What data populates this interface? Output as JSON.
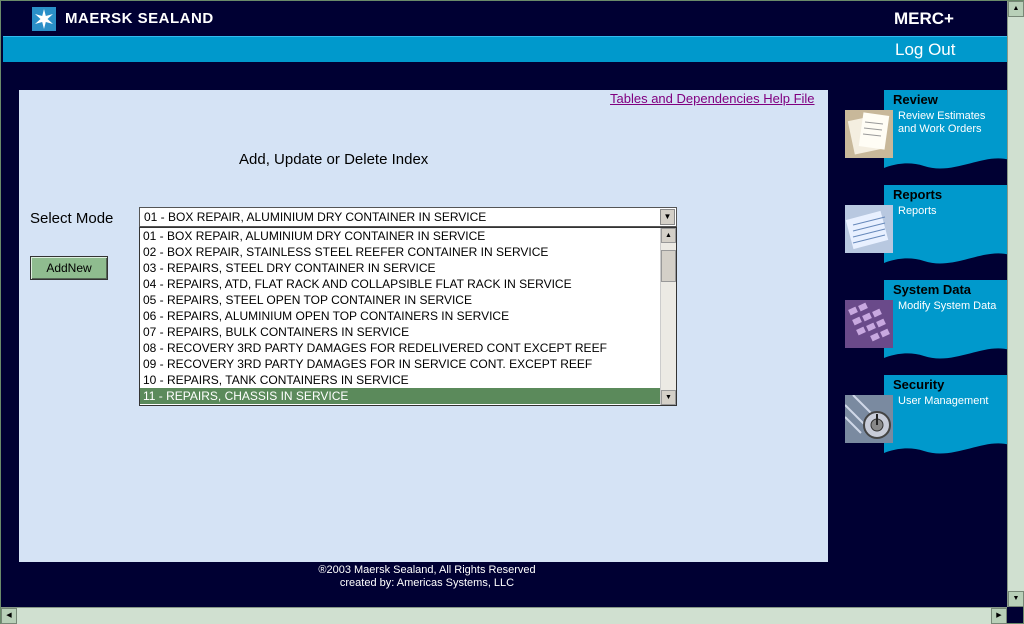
{
  "header": {
    "brand": "MAERSK SEALAND",
    "app_title": "MERC+",
    "logout": "Log Out"
  },
  "main": {
    "help_link": "Tables and Dependencies Help File",
    "title": "Add, Update or Delete Index",
    "select_mode_label": "Select Mode",
    "select_value": "01 - BOX REPAIR, ALUMINIUM DRY CONTAINER IN SERVICE",
    "add_new": "AddNew",
    "options": [
      "01 - BOX REPAIR, ALUMINIUM DRY CONTAINER IN SERVICE",
      "02 - BOX REPAIR, STAINLESS STEEL REEFER CONTAINER IN SERVICE",
      "03 - REPAIRS, STEEL DRY CONTAINER IN SERVICE",
      "04 - REPAIRS, ATD, FLAT RACK AND COLLAPSIBLE FLAT RACK IN SERVICE",
      "05 - REPAIRS, STEEL OPEN TOP CONTAINER IN SERVICE",
      "06 - REPAIRS, ALUMINIUM OPEN TOP CONTAINERS IN SERVICE",
      "07 - REPAIRS, BULK CONTAINERS IN SERVICE",
      "08 - RECOVERY 3RD PARTY DAMAGES FOR REDELIVERED CONT EXCEPT REEF",
      "09 - RECOVERY 3RD PARTY DAMAGES FOR IN SERVICE CONT. EXCEPT REEF",
      "10 - REPAIRS, TANK CONTAINERS IN SERVICE",
      "11 - REPAIRS, CHASSIS IN SERVICE"
    ],
    "selected_index": 10
  },
  "sidebar": [
    {
      "title": "Review",
      "links": [
        "Review Estimates",
        "and Work Orders"
      ],
      "icon": "documents-icon"
    },
    {
      "title": "Reports",
      "links": [
        "Reports"
      ],
      "icon": "reports-icon"
    },
    {
      "title": "System Data",
      "links": [
        "Modify System Data"
      ],
      "icon": "keyboard-icon"
    },
    {
      "title": "Security",
      "links": [
        "User Management"
      ],
      "icon": "lock-dial-icon"
    }
  ],
  "footer": {
    "copyright": "®2003 Maersk Sealand, All Rights Reserved",
    "created_by": "created by: Americas Systems, LLC"
  },
  "colors": {
    "background": "#000033",
    "accent_bar": "#0099cc",
    "panel": "#d5e3f5",
    "button": "#8fbc8f",
    "selected_option": "#5b8a5b"
  }
}
